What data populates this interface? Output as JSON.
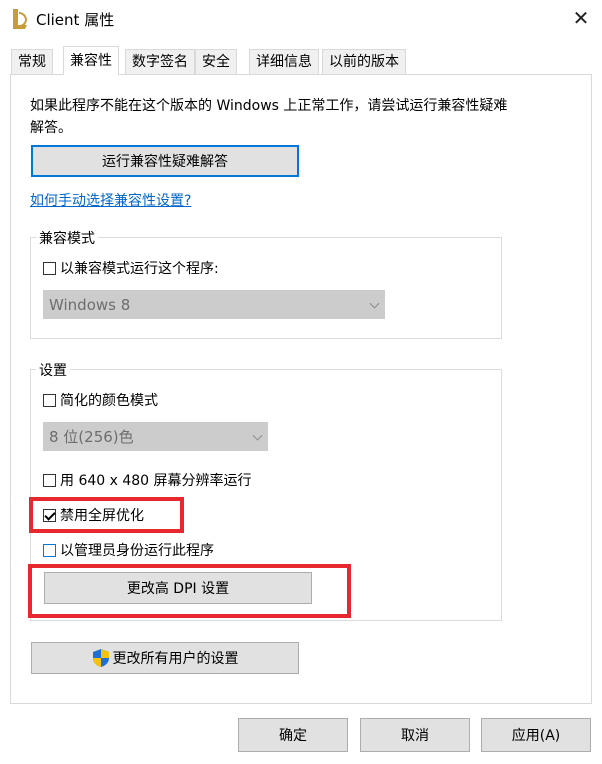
{
  "window": {
    "title": "Client 属性"
  },
  "tabs": [
    {
      "label": "常规"
    },
    {
      "label": "兼容性"
    },
    {
      "label": "数字签名"
    },
    {
      "label": "安全"
    },
    {
      "label": "详细信息"
    },
    {
      "label": "以前的版本"
    }
  ],
  "compat": {
    "description": "如果此程序不能在这个版本的 Windows 上正常工作，请尝试运行兼容性疑难解答。",
    "troubleshoot_button": "运行兼容性疑难解答",
    "manual_link": "如何手动选择兼容性设置?"
  },
  "compat_mode": {
    "legend": "兼容模式",
    "checkbox_label": "以兼容模式运行这个程序:",
    "os_select_value": "Windows 8"
  },
  "settings": {
    "legend": "设置",
    "reduced_color_label": "简化的颜色模式",
    "color_select_value": "8 位(256)色",
    "low_res_label": "用 640 x 480 屏幕分辨率运行",
    "disable_fullscreen_label": "禁用全屏优化",
    "run_as_admin_label": "以管理员身份运行此程序",
    "dpi_button": "更改高 DPI 设置"
  },
  "all_users_button": "更改所有用户的设置",
  "footer": {
    "ok": "确定",
    "cancel": "取消",
    "apply": "应用(A)"
  },
  "colors": {
    "accent": "#0078d7",
    "highlight": "#e8282f",
    "link": "#0066cc"
  }
}
